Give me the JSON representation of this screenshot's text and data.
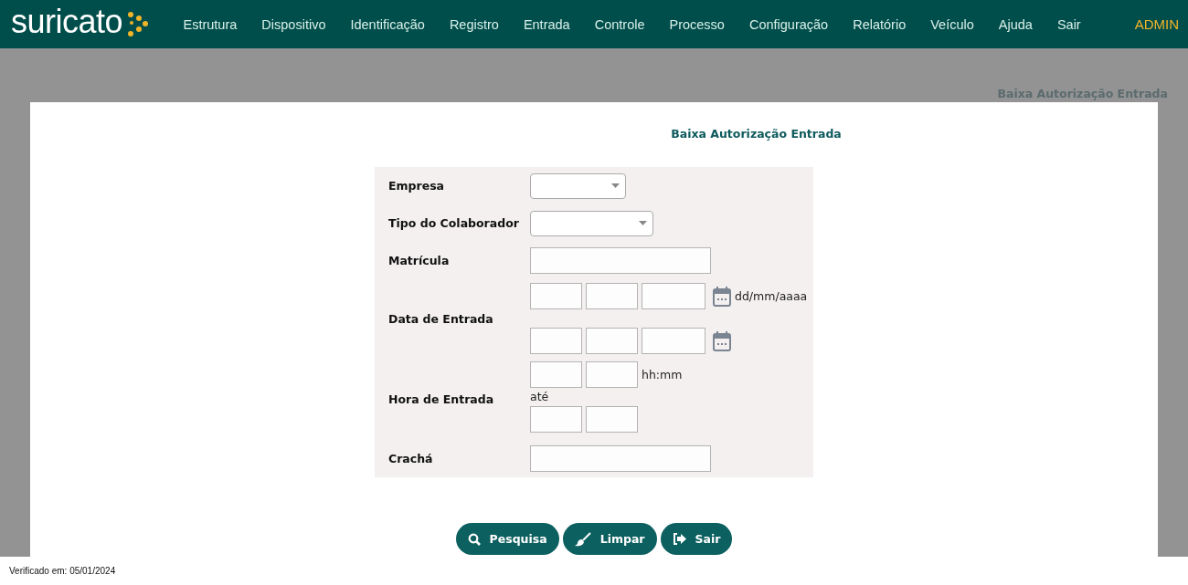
{
  "nav": {
    "logo": "suricato",
    "items": [
      "Estrutura",
      "Dispositivo",
      "Identificação",
      "Registro",
      "Entrada",
      "Controle",
      "Processo",
      "Configuração",
      "Relatório",
      "Veículo",
      "Ajuda",
      "Sair"
    ],
    "user": "ADMIN"
  },
  "breadcrumb": "Baixa Autorização Entrada",
  "form": {
    "title": "Baixa Autorização Entrada",
    "fields": [
      {
        "kind": "select",
        "label": "Empresa"
      },
      {
        "kind": "select",
        "label": "Tipo do Colaborador"
      },
      {
        "kind": "text",
        "label": "Matrícula"
      },
      {
        "kind": "date_range",
        "label": "Data de Entrada",
        "hint": "dd/mm/aaaa"
      },
      {
        "kind": "time_range",
        "label": "Hora de Entrada",
        "hint": "hh:mm",
        "separator": "até"
      },
      {
        "kind": "text",
        "label": "Crachá"
      }
    ]
  },
  "buttons": [
    {
      "kind": "search",
      "label": "Pesquisa"
    },
    {
      "kind": "clear",
      "label": "Limpar"
    },
    {
      "kind": "exit",
      "label": "Sair"
    }
  ],
  "footer": "Verificado em: 05/01/2024"
}
